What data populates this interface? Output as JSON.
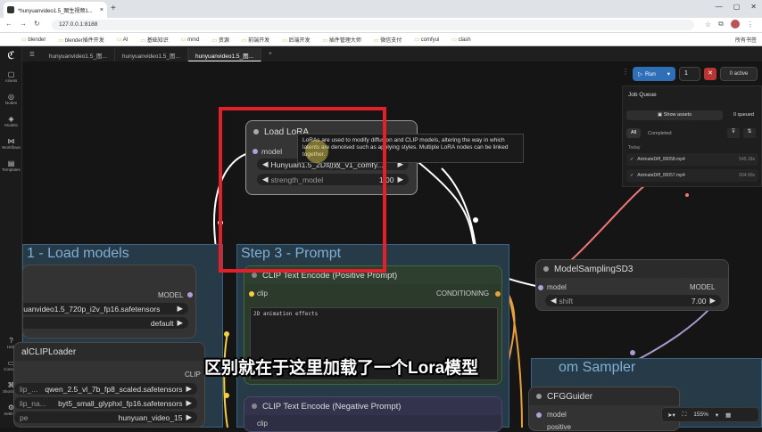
{
  "browser": {
    "tab_title": "*hunyuanvideo1.5_图生视频1...",
    "url": "127.0.0.1:8188",
    "bookmarks": [
      "blender",
      "blender插件开发",
      "AI",
      "基础知识",
      "mmd",
      "资源",
      "前端开发",
      "后端开发",
      "插件管理大师",
      "微信支付",
      "comfyui",
      "clash"
    ],
    "all_bookmarks": "所有书签"
  },
  "sidebar": {
    "items": [
      {
        "label": "Assets",
        "icon": "assets-icon"
      },
      {
        "label": "Nodes",
        "icon": "nodes-icon"
      },
      {
        "label": "Models",
        "icon": "models-icon"
      },
      {
        "label": "Workflows",
        "icon": "workflows-icon"
      },
      {
        "label": "Templates",
        "icon": "templates-icon"
      }
    ],
    "bottom": [
      {
        "label": "Help",
        "icon": "help-icon"
      },
      {
        "label": "Console",
        "icon": "console-icon"
      },
      {
        "label": "Shortcuts",
        "icon": "shortcuts-icon"
      },
      {
        "label": "Settings",
        "icon": "settings-icon"
      }
    ]
  },
  "tabs": [
    "hunyuanvideo1.5_图...",
    "hunyuanvideo1.5_图...",
    "hunyuanvideo1.5_图..."
  ],
  "run": {
    "label": "Run",
    "count": "1",
    "active": "0 active"
  },
  "queue": {
    "title": "Job Queue",
    "show_assets": "Show assets",
    "queued": "0 queued",
    "filter_all": "All",
    "filter_completed": "Completed",
    "section": "Today",
    "jobs": [
      {
        "name": "AnimateDiff_00058.mp4",
        "time": "545.18s"
      },
      {
        "name": "AnimateDiff_00057.mp4",
        "time": "604.90s"
      }
    ]
  },
  "groups": {
    "load_models": "1 - Load models",
    "prompt": "Step 3 - Prompt",
    "sampler": "om Sampler"
  },
  "lora": {
    "title": "Load LoRA",
    "input": "model",
    "lora_name": "Hunyuan1.5_2D动效_v1_comfy...",
    "strength_label": "strength_model",
    "strength_value": "1.00",
    "tooltip": "LoRAs are used to modify diffusion and CLIP models, altering the way in which latents are denoised such as applying styles. Multiple LoRA nodes can be linked together."
  },
  "unet": {
    "output": "MODEL",
    "name": "yuanvideo1.5_720p_i2v_fp16.safetensors",
    "dtype": "default"
  },
  "clip_loader": {
    "title": "alCLIPLoader",
    "output": "CLIP",
    "clip1_label": "lip_...",
    "clip1": "qwen_2.5_vl_7b_fp8_scaled.safetensors",
    "clip2_label": "lip_na...",
    "clip2": "byt5_small_glyphxl_fp16.safetensors",
    "type_label": "pe",
    "type": "hunyuan_video_15"
  },
  "clip_pos": {
    "title": "CLIP Text Encode (Positive Prompt)",
    "input": "clip",
    "output": "CONDITIONING",
    "text": "2D animation effects"
  },
  "clip_neg": {
    "title": "CLIP Text Encode (Negative Prompt)",
    "input": "clip"
  },
  "sampling": {
    "title": "ModelSamplingSD3",
    "input": "model",
    "output": "MODEL",
    "shift_label": "shift",
    "shift_value": "7.00"
  },
  "guider": {
    "title": "CFGGuider",
    "input": "model",
    "input2": "positive"
  },
  "zoom": "155%",
  "subtitle": "区别就在于这里加载了一个Lora模型"
}
